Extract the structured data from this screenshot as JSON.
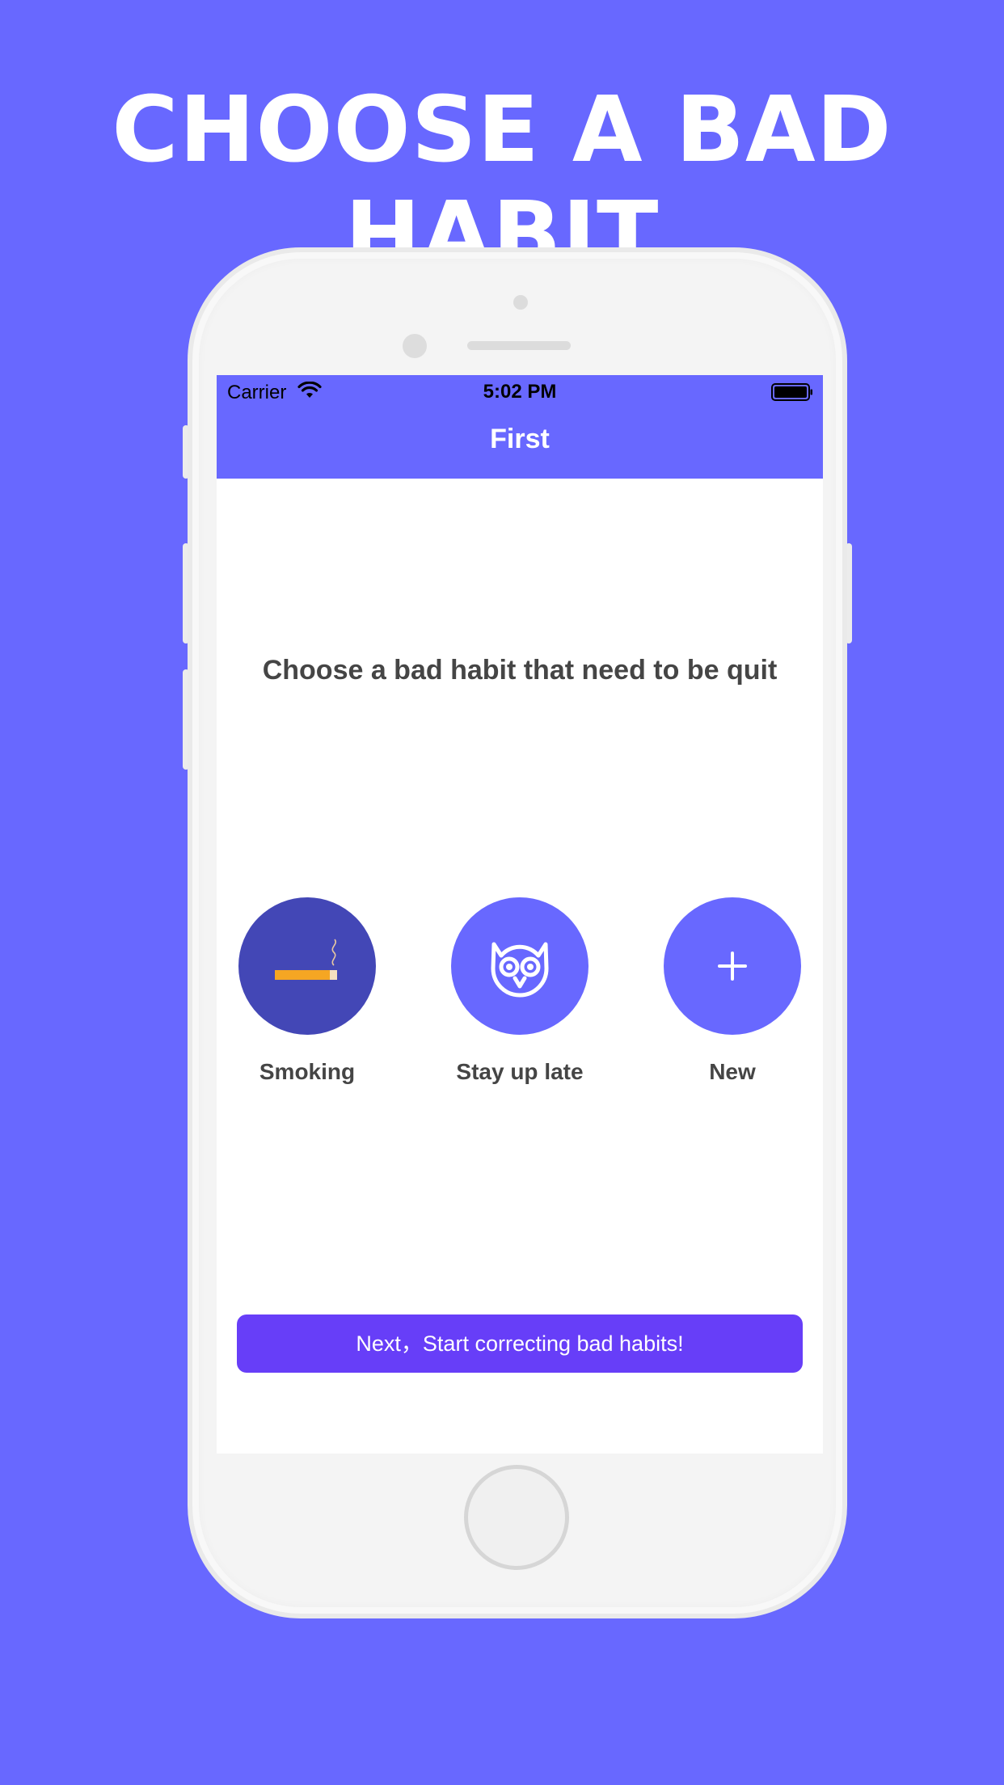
{
  "promo": {
    "headline": "CHOOSE A BAD HABIT"
  },
  "status_bar": {
    "carrier": "Carrier",
    "time": "5:02 PM",
    "wifi_icon": "wifi-icon",
    "battery_icon": "battery-icon"
  },
  "nav": {
    "title": "First"
  },
  "main": {
    "prompt": "Choose a bad habit that need to be quit",
    "habits": [
      {
        "label": "Smoking",
        "icon": "cigarette-icon",
        "selected": true
      },
      {
        "label": "Stay up late",
        "icon": "owl-icon",
        "selected": false
      },
      {
        "label": "New",
        "icon": "plus-icon",
        "selected": false
      }
    ],
    "next_button": "Next，Start correcting bad habits!"
  },
  "colors": {
    "background": "#6868ff",
    "accent": "#6868ff",
    "selected": "#4347b6",
    "button": "#673ef8",
    "cigarette": "#f5a623"
  }
}
